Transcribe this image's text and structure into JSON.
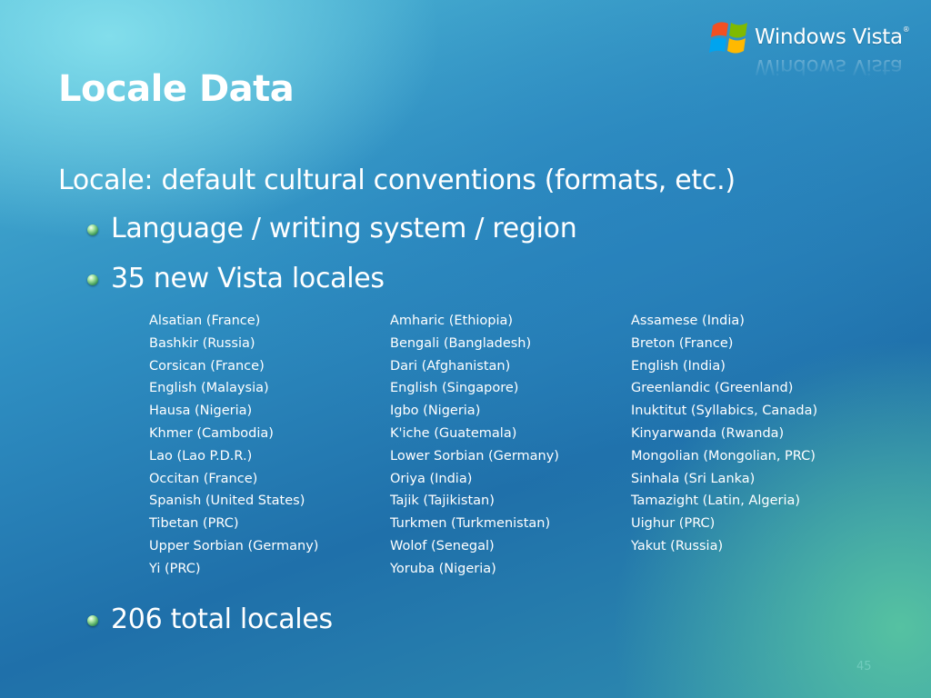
{
  "slide": {
    "title": "Locale Data",
    "page_number": "45"
  },
  "logo": {
    "text": "Windows Vista",
    "trademark": "®"
  },
  "content": {
    "heading": "Locale: default cultural conventions (formats, etc.)",
    "bullets": [
      "Language / writing system / region",
      "35 new Vista locales",
      "206 total locales"
    ],
    "locales": [
      "Alsatian (France)",
      "Amharic (Ethiopia)",
      "Assamese (India)",
      "Bashkir (Russia)",
      "Bengali (Bangladesh)",
      "Breton (France)",
      "Corsican (France)",
      "Dari (Afghanistan)",
      "English (India)",
      "English (Malaysia)",
      "English (Singapore)",
      "Greenlandic (Greenland)",
      "Hausa (Nigeria)",
      "Igbo (Nigeria)",
      "Inuktitut (Syllabics, Canada)",
      "Khmer (Cambodia)",
      "K'iche (Guatemala)",
      "Kinyarwanda (Rwanda)",
      "Lao (Lao P.D.R.)",
      "Lower Sorbian (Germany)",
      "Mongolian (Mongolian, PRC)",
      "Occitan (France)",
      "Oriya (India)",
      "Sinhala (Sri Lanka)",
      "Spanish (United States)",
      "Tajik (Tajikistan)",
      "Tamazight (Latin, Algeria)",
      "Tibetan (PRC)",
      "Turkmen (Turkmenistan)",
      "Uighur (PRC)",
      "Upper Sorbian (Germany)",
      "Wolof (Senegal)",
      "Yakut (Russia)",
      "Yi (PRC)",
      "Yoruba (Nigeria)"
    ]
  },
  "colors": {
    "background_top": "#4fb8d6",
    "background_mid": "#1f70aa",
    "background_accent": "#5ac8a0",
    "text": "#ffffff",
    "bullet": "#6fc27a"
  }
}
